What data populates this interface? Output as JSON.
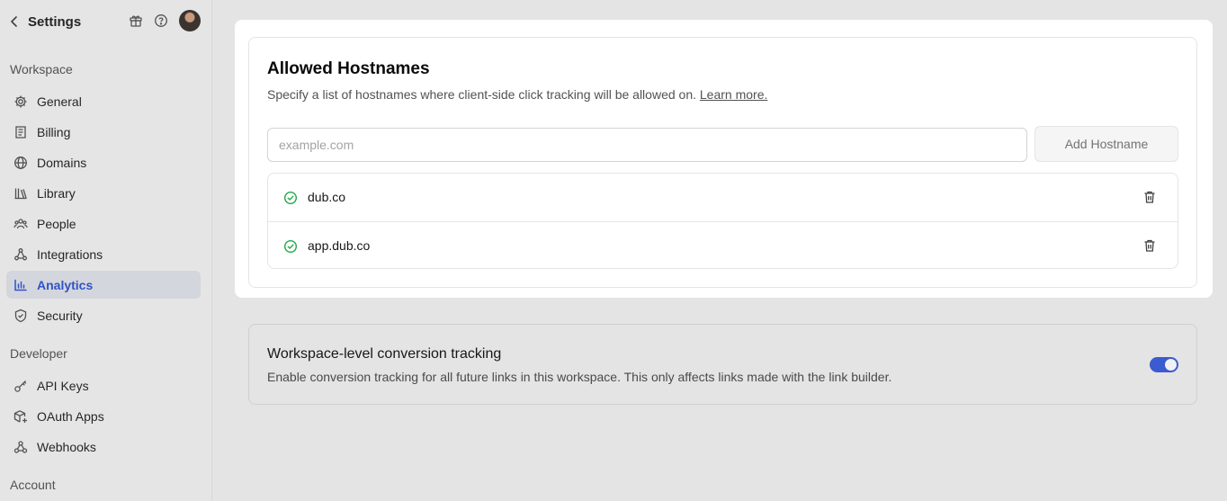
{
  "sidebar": {
    "title": "Settings",
    "sections": {
      "workspace": "Workspace",
      "developer": "Developer",
      "account": "Account"
    },
    "items": [
      {
        "label": "General",
        "icon": "gear-icon"
      },
      {
        "label": "Billing",
        "icon": "receipt-icon"
      },
      {
        "label": "Domains",
        "icon": "globe-icon"
      },
      {
        "label": "Library",
        "icon": "library-icon"
      },
      {
        "label": "People",
        "icon": "people-icon"
      },
      {
        "label": "Integrations",
        "icon": "integrations-icon"
      },
      {
        "label": "Analytics",
        "icon": "analytics-icon",
        "active": true
      },
      {
        "label": "Security",
        "icon": "shield-icon"
      }
    ],
    "dev_items": [
      {
        "label": "API Keys",
        "icon": "key-icon"
      },
      {
        "label": "OAuth Apps",
        "icon": "cube-plus-icon"
      },
      {
        "label": "Webhooks",
        "icon": "webhook-icon"
      }
    ]
  },
  "modal": {
    "title": "Allowed Hostnames",
    "description": "Specify a list of hostnames where client-side click tracking will be allowed on.",
    "learn_more": "Learn more.",
    "input_placeholder": "example.com",
    "add_button": "Add Hostname",
    "hostnames": [
      "dub.co",
      "app.dub.co"
    ]
  },
  "conversion": {
    "title": "Workspace-level conversion tracking",
    "description": "Enable conversion tracking for all future links in this workspace. This only affects links made with the link builder.",
    "enabled": true
  },
  "colors": {
    "accent": "#3b5bd0",
    "active_text": "#2f54c5",
    "success": "#22a84a"
  }
}
